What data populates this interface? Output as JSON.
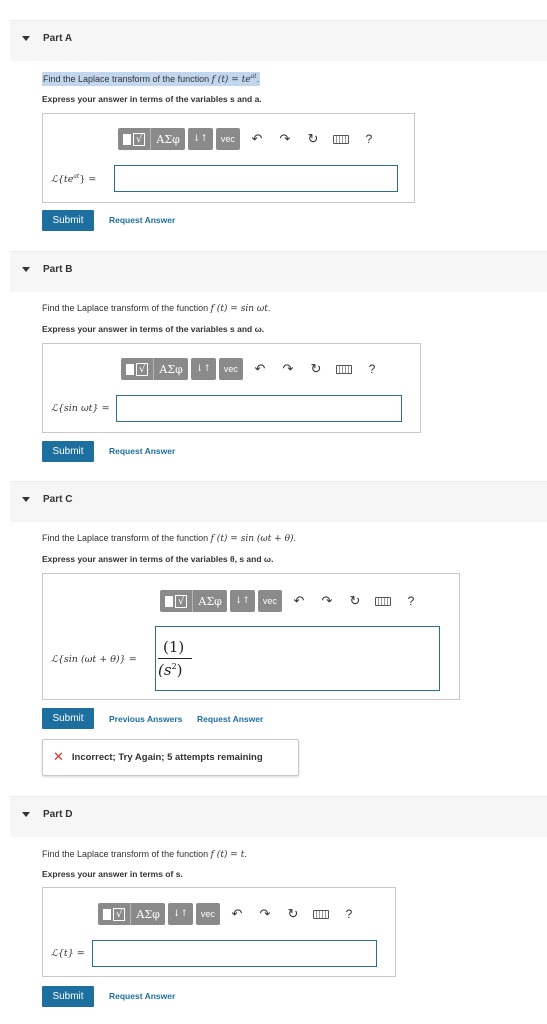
{
  "parts": [
    {
      "title": "Part A",
      "question_prefix": "Find the Laplace transform of the function ",
      "function": "f (t) = te",
      "function_sup": "at",
      "question_suffix": ".",
      "instruction": "Express your answer in terms of the variables s and a.",
      "lhs": "ℒ{te",
      "lhs_sup": "at",
      "lhs_close": "} =",
      "submit_label": "Submit",
      "request_label": "Request Answer"
    },
    {
      "title": "Part B",
      "question_prefix": "Find the Laplace transform of the function ",
      "function": "f (t) = sin ωt",
      "question_suffix": ".",
      "instruction": "Express your answer in terms of the variables s and ω.",
      "lhs": "ℒ{sin ωt} =",
      "submit_label": "Submit",
      "request_label": "Request Answer"
    },
    {
      "title": "Part C",
      "question_prefix": "Find the Laplace transform of the function ",
      "function": "f (t) = sin (ωt + θ)",
      "question_suffix": ".",
      "instruction": "Express your answer in terms of the variables θ, s and ω.",
      "lhs": "ℒ{sin (ωt + θ)} =",
      "answer_numerator": "(1)",
      "answer_denominator": "(s",
      "answer_den_sup": "2",
      "answer_den_close": ")",
      "submit_label": "Submit",
      "previous_label": "Previous Answers",
      "request_label": "Request Answer",
      "feedback": "Incorrect; Try Again; 5 attempts remaining"
    },
    {
      "title": "Part D",
      "question_prefix": "Find the Laplace transform of the function ",
      "function": "f (t) = t",
      "question_suffix": ".",
      "instruction": "Express your answer in terms of s.",
      "lhs": "ℒ{t} =",
      "submit_label": "Submit",
      "request_label": "Request Answer"
    }
  ],
  "toolbar": {
    "template_glyph": "√",
    "greek_label": "ΑΣφ",
    "updown_label": "↓↑",
    "vec_label": "vec",
    "undo_glyph": "↶",
    "redo_glyph": "↷",
    "reset_glyph": "↻",
    "help_label": "?"
  },
  "colors": {
    "accent": "#1d6fa0",
    "highlight": "#c2d7ee",
    "error": "#d9312b",
    "toolbar_bg": "#8a8a8a"
  },
  "icons": [
    "caret-down-icon",
    "undo-icon",
    "redo-icon",
    "reset-icon",
    "keyboard-icon",
    "help-icon",
    "x-error-icon"
  ]
}
